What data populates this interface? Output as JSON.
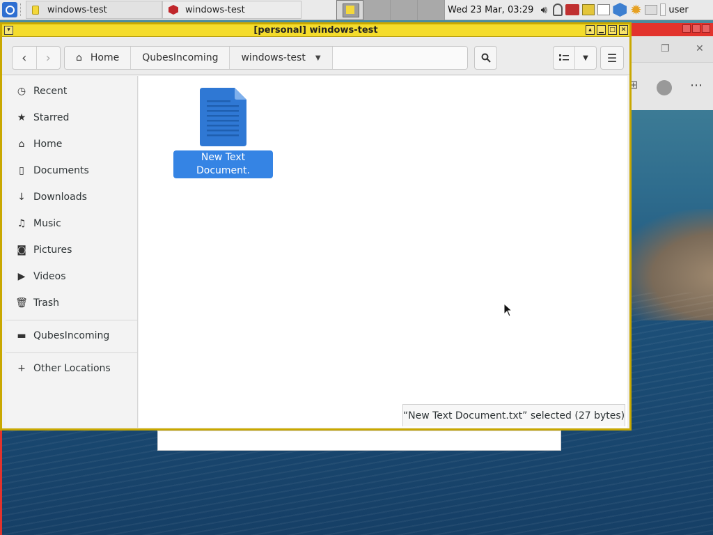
{
  "taskbar": {
    "tasks": [
      {
        "label": "windows-test",
        "icon": "yellow-window-icon"
      },
      {
        "label": "windows-test",
        "icon": "red-qube-icon"
      }
    ],
    "clock": "Wed 23 Mar, 03:29",
    "user": "user"
  },
  "window": {
    "title": "[personal] windows-test",
    "frame_color": "#f4dc2c",
    "controls": [
      "minimize",
      "maximize",
      "close"
    ]
  },
  "pathbar": {
    "crumbs": [
      "Home",
      "QubesIncoming",
      "windows-test"
    ]
  },
  "sidebar": {
    "items": [
      {
        "label": "Recent",
        "icon": "clock-icon"
      },
      {
        "label": "Starred",
        "icon": "star-icon"
      },
      {
        "label": "Home",
        "icon": "home-icon"
      },
      {
        "label": "Documents",
        "icon": "document-icon"
      },
      {
        "label": "Downloads",
        "icon": "download-icon"
      },
      {
        "label": "Music",
        "icon": "music-icon"
      },
      {
        "label": "Pictures",
        "icon": "camera-icon"
      },
      {
        "label": "Videos",
        "icon": "video-icon"
      },
      {
        "label": "Trash",
        "icon": "trash-icon"
      }
    ],
    "bookmarks": [
      {
        "label": "QubesIncoming",
        "icon": "folder-icon"
      }
    ],
    "other": {
      "label": "Other Locations",
      "icon": "plus-icon"
    }
  },
  "files": [
    {
      "name": "New Text Document.\ntxt",
      "type": "text-file-icon",
      "selected": true
    }
  ],
  "status": "“New Text Document.txt” selected  (27 bytes)",
  "colors": {
    "selection": "#3584e4",
    "window_border": "#c9a800",
    "other_window_border": "#e2332d"
  }
}
